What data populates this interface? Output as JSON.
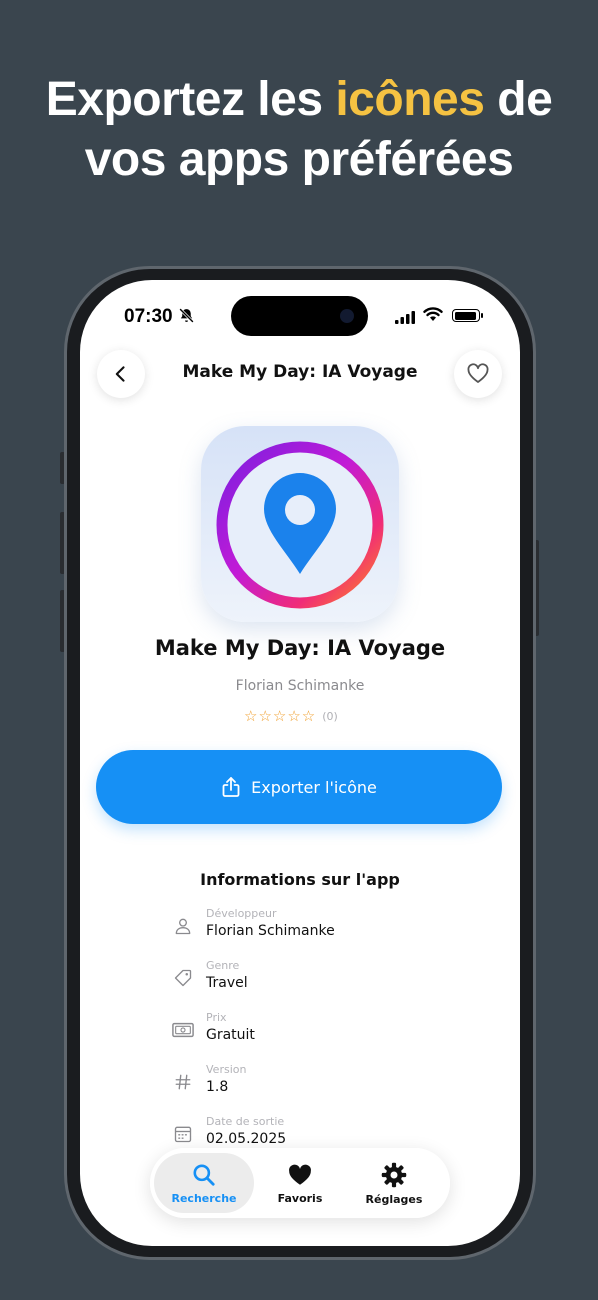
{
  "headline": {
    "line1_before": "Exportez les ",
    "line1_accent": "icônes",
    "line1_after": " de",
    "line2": "vos apps préférées",
    "accent_color": "#f5c242"
  },
  "status_bar": {
    "time": "07:30",
    "icons": [
      "bell-slash-icon",
      "signal-icon",
      "wifi-icon",
      "battery-icon"
    ]
  },
  "nav": {
    "title": "Make My Day: IA Voyage",
    "back_icon": "chevron-left-icon",
    "favorite_icon": "heart-outline-icon"
  },
  "app": {
    "name": "Make My Day: IA Voyage",
    "developer": "Florian Schimanke",
    "stars": "☆☆☆☆☆",
    "rating_count": "(0)",
    "icon": "map-pin-icon"
  },
  "export_button": {
    "label": "Exporter l'icône",
    "icon": "share-icon",
    "color": "#1690f5"
  },
  "info": {
    "title": "Informations sur l'app",
    "rows": [
      {
        "label": "Développeur",
        "value": "Florian Schimanke",
        "icon": "person-icon"
      },
      {
        "label": "Genre",
        "value": "Travel",
        "icon": "tag-icon"
      },
      {
        "label": "Prix",
        "value": "Gratuit",
        "icon": "banknote-icon"
      },
      {
        "label": "Version",
        "value": "1.8",
        "icon": "number-icon"
      },
      {
        "label": "Date de sortie",
        "value": "02.05.2025",
        "icon": "calendar-icon"
      }
    ]
  },
  "tabbar": {
    "tabs": [
      {
        "label": "Recherche",
        "icon": "search-icon",
        "active": true
      },
      {
        "label": "Favoris",
        "icon": "heart-filled-icon",
        "active": false
      },
      {
        "label": "Réglages",
        "icon": "gear-icon",
        "active": false
      }
    ]
  }
}
